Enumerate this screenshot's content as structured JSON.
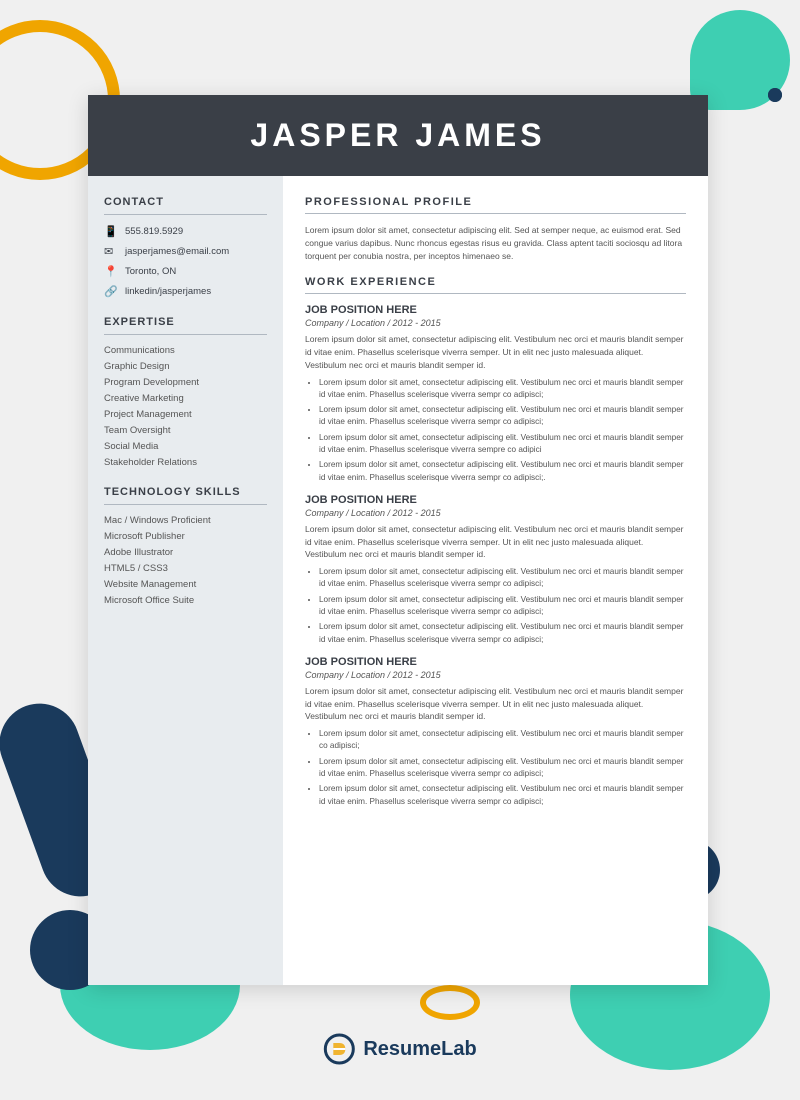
{
  "header": {
    "name": "JASPER JAMES"
  },
  "sidebar": {
    "contact_title": "CONTACT",
    "contact_items": [
      {
        "icon": "📱",
        "text": "555.819.5929"
      },
      {
        "icon": "✉",
        "text": "jasperjames@email.com"
      },
      {
        "icon": "📍",
        "text": "Toronto, ON"
      },
      {
        "icon": "🔗",
        "text": "linkedin/jasperjames"
      }
    ],
    "expertise_title": "EXPERTISE",
    "expertise_items": [
      "Communications",
      "Graphic Design",
      "Program Development",
      "Creative Marketing",
      "Project Management",
      "Team Oversight",
      "Social Media",
      "Stakeholder Relations"
    ],
    "tech_title": "TECHNOLOGY SKILLS",
    "tech_items": [
      "Mac / Windows Proficient",
      "Microsoft Publisher",
      "Adobe Illustrator",
      "HTML5 / CSS3",
      "Website Management",
      "Microsoft Office Suite"
    ]
  },
  "main": {
    "profile_title": "PROFESSIONAL PROFILE",
    "profile_text": "Lorem ipsum dolor sit amet, consectetur adipiscing elit. Sed at semper neque, ac euismod erat. Sed congue varius dapibus. Nunc rhoncus egestas risus eu gravida. Class aptent taciti sociosqu ad litora torquent per conubia nostra, per inceptos himenaeo se.",
    "work_title": "WORK EXPERIENCE",
    "jobs": [
      {
        "title": "JOB POSITION HERE",
        "subtitle": "Company / Location / 2012 - 2015",
        "desc": "Lorem ipsum dolor sit amet, consectetur adipiscing elit. Vestibulum nec orci et mauris blandit semper id vitae enim. Phasellus scelerisque viverra semper. Ut in elit nec justo malesuada aliquet. Vestibulum nec orci et mauris blandit semper id.",
        "bullets": [
          "Lorem ipsum dolor sit amet, consectetur adipiscing elit. Vestibulum nec orci et mauris blandit semper id vitae enim. Phasellus scelerisque viverra sempr co adipisci;",
          "Lorem ipsum dolor sit amet, consectetur adipiscing elit. Vestibulum nec orci et mauris blandit semper id vitae enim. Phasellus scelerisque viverra sempr co adipisci;",
          "Lorem ipsum dolor sit amet, consectetur adipiscing elit. Vestibulum nec orci et mauris blandit semper id vitae enim. Phasellus scelerisque viverra sempre co adipici",
          "Lorem ipsum dolor sit amet, consectetur adipiscing elit. Vestibulum nec orci et mauris blandit semper id vitae enim. Phasellus scelerisque viverra sempr co adipisci;."
        ]
      },
      {
        "title": "JOB POSITION HERE",
        "subtitle": "Company / Location /  2012 - 2015",
        "desc": "Lorem ipsum dolor sit amet, consectetur adipiscing elit. Vestibulum nec orci et mauris blandit semper id vitae enim. Phasellus scelerisque viverra semper. Ut in elit nec justo malesuada aliquet. Vestibulum nec orci et mauris blandit semper id.",
        "bullets": [
          "Lorem ipsum dolor sit amet, consectetur adipiscing elit. Vestibulum nec orci et mauris blandit semper id vitae enim. Phasellus scelerisque viverra sempr co adipisci;",
          "Lorem ipsum dolor sit amet, consectetur adipiscing elit. Vestibulum nec orci et mauris blandit semper id vitae enim. Phasellus scelerisque viverra sempr co adipisci;",
          "Lorem ipsum dolor sit amet, consectetur adipiscing elit. Vestibulum nec orci et mauris blandit semper id vitae enim. Phasellus scelerisque viverra sempr co adipisci;"
        ]
      },
      {
        "title": "JOB POSITION HERE",
        "subtitle": "Company / Location / 2012 - 2015",
        "desc": "Lorem ipsum dolor sit amet, consectetur adipiscing elit. Vestibulum nec orci et mauris blandit semper id vitae enim. Phasellus scelerisque viverra semper. Ut in elit nec justo malesuada aliquet. Vestibulum nec orci et mauris blandit semper id.",
        "bullets": [
          "Lorem ipsum dolor sit amet, consectetur adipiscing elit. Vestibulum nec orci et mauris blandit semper co adipisci;",
          "Lorem ipsum dolor sit amet, consectetur adipiscing elit. Vestibulum nec orci et mauris blandit semper id vitae enim. Phasellus scelerisque viverra sempr co adipisci;",
          "Lorem ipsum dolor sit amet, consectetur adipiscing elit. Vestibulum nec orci et mauris blandit semper id vitae enim. Phasellus scelerisque viverra sempr co adipisci;"
        ]
      }
    ]
  },
  "logo": {
    "text_regular": "Resume",
    "text_bold": "Lab"
  }
}
